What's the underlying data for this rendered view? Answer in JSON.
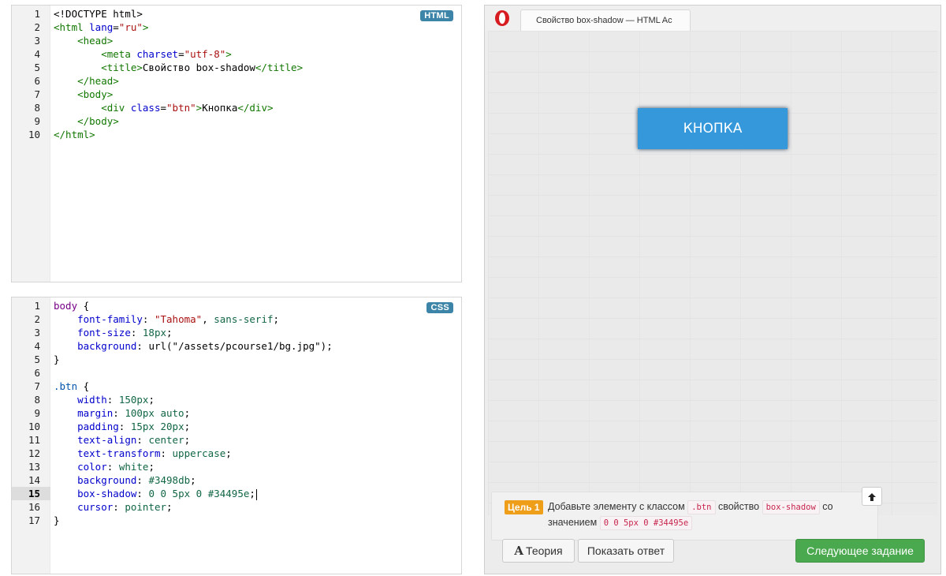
{
  "html_editor": {
    "badge": "HTML",
    "lines": [
      {
        "n": "1",
        "parts": [
          {
            "t": "<!DOCTYPE html>",
            "c": "txt"
          }
        ]
      },
      {
        "n": "2",
        "parts": [
          {
            "t": "<html ",
            "c": "tag"
          },
          {
            "t": "lang",
            "c": "attr"
          },
          {
            "t": "=",
            "c": "txt"
          },
          {
            "t": "\"ru\"",
            "c": "str"
          },
          {
            "t": ">",
            "c": "tag"
          }
        ]
      },
      {
        "n": "3",
        "parts": [
          {
            "t": "    ",
            "c": "txt"
          },
          {
            "t": "<head>",
            "c": "tag"
          }
        ]
      },
      {
        "n": "4",
        "parts": [
          {
            "t": "        ",
            "c": "txt"
          },
          {
            "t": "<meta ",
            "c": "tag"
          },
          {
            "t": "charset",
            "c": "attr"
          },
          {
            "t": "=",
            "c": "txt"
          },
          {
            "t": "\"utf-8\"",
            "c": "str"
          },
          {
            "t": ">",
            "c": "tag"
          }
        ]
      },
      {
        "n": "5",
        "parts": [
          {
            "t": "        ",
            "c": "txt"
          },
          {
            "t": "<title>",
            "c": "tag"
          },
          {
            "t": "Свойство box-shadow",
            "c": "txt"
          },
          {
            "t": "</title>",
            "c": "tag"
          }
        ]
      },
      {
        "n": "6",
        "parts": [
          {
            "t": "    ",
            "c": "txt"
          },
          {
            "t": "</head>",
            "c": "tag"
          }
        ]
      },
      {
        "n": "7",
        "parts": [
          {
            "t": "    ",
            "c": "txt"
          },
          {
            "t": "<body>",
            "c": "tag"
          }
        ]
      },
      {
        "n": "8",
        "parts": [
          {
            "t": "        ",
            "c": "txt"
          },
          {
            "t": "<div ",
            "c": "tag"
          },
          {
            "t": "class",
            "c": "attr"
          },
          {
            "t": "=",
            "c": "txt"
          },
          {
            "t": "\"btn\"",
            "c": "str"
          },
          {
            "t": ">",
            "c": "tag"
          },
          {
            "t": "Кнопка",
            "c": "txt"
          },
          {
            "t": "</div>",
            "c": "tag"
          }
        ]
      },
      {
        "n": "9",
        "parts": [
          {
            "t": "    ",
            "c": "txt"
          },
          {
            "t": "</body>",
            "c": "tag"
          }
        ]
      },
      {
        "n": "10",
        "parts": [
          {
            "t": "</html>",
            "c": "tag"
          }
        ]
      }
    ]
  },
  "css_editor": {
    "badge": "CSS",
    "active_line": "15",
    "lines": [
      {
        "n": "1",
        "parts": [
          {
            "t": "body",
            "c": "kw"
          },
          {
            "t": " {",
            "c": "txt"
          }
        ]
      },
      {
        "n": "2",
        "parts": [
          {
            "t": "    ",
            "c": "txt"
          },
          {
            "t": "font-family",
            "c": "prop"
          },
          {
            "t": ": ",
            "c": "txt"
          },
          {
            "t": "\"Tahoma\"",
            "c": "str"
          },
          {
            "t": ", ",
            "c": "txt"
          },
          {
            "t": "sans-serif",
            "c": "num"
          },
          {
            "t": ";",
            "c": "txt"
          }
        ]
      },
      {
        "n": "3",
        "parts": [
          {
            "t": "    ",
            "c": "txt"
          },
          {
            "t": "font-size",
            "c": "prop"
          },
          {
            "t": ": ",
            "c": "txt"
          },
          {
            "t": "18px",
            "c": "num"
          },
          {
            "t": ";",
            "c": "txt"
          }
        ]
      },
      {
        "n": "4",
        "parts": [
          {
            "t": "    ",
            "c": "txt"
          },
          {
            "t": "background",
            "c": "prop"
          },
          {
            "t": ": ",
            "c": "txt"
          },
          {
            "t": "url(\"/assets/pcourse1/bg.jpg\")",
            "c": "txt"
          },
          {
            "t": ";",
            "c": "txt"
          }
        ]
      },
      {
        "n": "5",
        "parts": [
          {
            "t": "}",
            "c": "txt"
          }
        ]
      },
      {
        "n": "6",
        "parts": [
          {
            "t": "",
            "c": "txt"
          }
        ]
      },
      {
        "n": "7",
        "parts": [
          {
            "t": ".btn",
            "c": "sel"
          },
          {
            "t": " {",
            "c": "txt"
          }
        ]
      },
      {
        "n": "8",
        "parts": [
          {
            "t": "    ",
            "c": "txt"
          },
          {
            "t": "width",
            "c": "prop"
          },
          {
            "t": ": ",
            "c": "txt"
          },
          {
            "t": "150px",
            "c": "num"
          },
          {
            "t": ";",
            "c": "txt"
          }
        ]
      },
      {
        "n": "9",
        "parts": [
          {
            "t": "    ",
            "c": "txt"
          },
          {
            "t": "margin",
            "c": "prop"
          },
          {
            "t": ": ",
            "c": "txt"
          },
          {
            "t": "100px auto",
            "c": "num"
          },
          {
            "t": ";",
            "c": "txt"
          }
        ]
      },
      {
        "n": "10",
        "parts": [
          {
            "t": "    ",
            "c": "txt"
          },
          {
            "t": "padding",
            "c": "prop"
          },
          {
            "t": ": ",
            "c": "txt"
          },
          {
            "t": "15px 20px",
            "c": "num"
          },
          {
            "t": ";",
            "c": "txt"
          }
        ]
      },
      {
        "n": "11",
        "parts": [
          {
            "t": "    ",
            "c": "txt"
          },
          {
            "t": "text-align",
            "c": "prop"
          },
          {
            "t": ": ",
            "c": "txt"
          },
          {
            "t": "center",
            "c": "num"
          },
          {
            "t": ";",
            "c": "txt"
          }
        ]
      },
      {
        "n": "12",
        "parts": [
          {
            "t": "    ",
            "c": "txt"
          },
          {
            "t": "text-transform",
            "c": "prop"
          },
          {
            "t": ": ",
            "c": "txt"
          },
          {
            "t": "uppercase",
            "c": "num"
          },
          {
            "t": ";",
            "c": "txt"
          }
        ]
      },
      {
        "n": "13",
        "parts": [
          {
            "t": "    ",
            "c": "txt"
          },
          {
            "t": "color",
            "c": "prop"
          },
          {
            "t": ": ",
            "c": "txt"
          },
          {
            "t": "white",
            "c": "num"
          },
          {
            "t": ";",
            "c": "txt"
          }
        ]
      },
      {
        "n": "14",
        "parts": [
          {
            "t": "    ",
            "c": "txt"
          },
          {
            "t": "background",
            "c": "prop"
          },
          {
            "t": ": ",
            "c": "txt"
          },
          {
            "t": "#3498db",
            "c": "num"
          },
          {
            "t": ";",
            "c": "txt"
          }
        ]
      },
      {
        "n": "15",
        "parts": [
          {
            "t": "    ",
            "c": "txt"
          },
          {
            "t": "box-shadow",
            "c": "prop"
          },
          {
            "t": ": ",
            "c": "txt"
          },
          {
            "t": "0 0 5px 0 #34495e",
            "c": "num"
          },
          {
            "t": ";",
            "c": "txt"
          }
        ]
      },
      {
        "n": "16",
        "parts": [
          {
            "t": "    ",
            "c": "txt"
          },
          {
            "t": "cursor",
            "c": "prop"
          },
          {
            "t": ": ",
            "c": "txt"
          },
          {
            "t": "pointer",
            "c": "num"
          },
          {
            "t": ";",
            "c": "txt"
          }
        ]
      },
      {
        "n": "17",
        "parts": [
          {
            "t": "}",
            "c": "txt"
          }
        ]
      }
    ]
  },
  "preview": {
    "tab_title": "Свойство box-shadow — HTML Ac",
    "demo_button_label": "Кнопка",
    "demo_button_color": "#3498db"
  },
  "task": {
    "goal_label": "Цель 1",
    "text_1": "Добавьте элементу с классом",
    "code_1": ".btn",
    "text_2": "свойство",
    "code_2": "box-shadow",
    "text_3": "со значением",
    "code_3": "0 0 5px 0 #34495e",
    "collapse_icon": "arrow-up-icon"
  },
  "actions": {
    "theory_icon": "A",
    "theory_label": "Теория",
    "answer_label": "Показать ответ",
    "next_label": "Следующее задание"
  },
  "colors": {
    "badge_bg": "#3d85a8",
    "goal_badge": "#ef9e1a",
    "next_button": "#4aa94f"
  }
}
